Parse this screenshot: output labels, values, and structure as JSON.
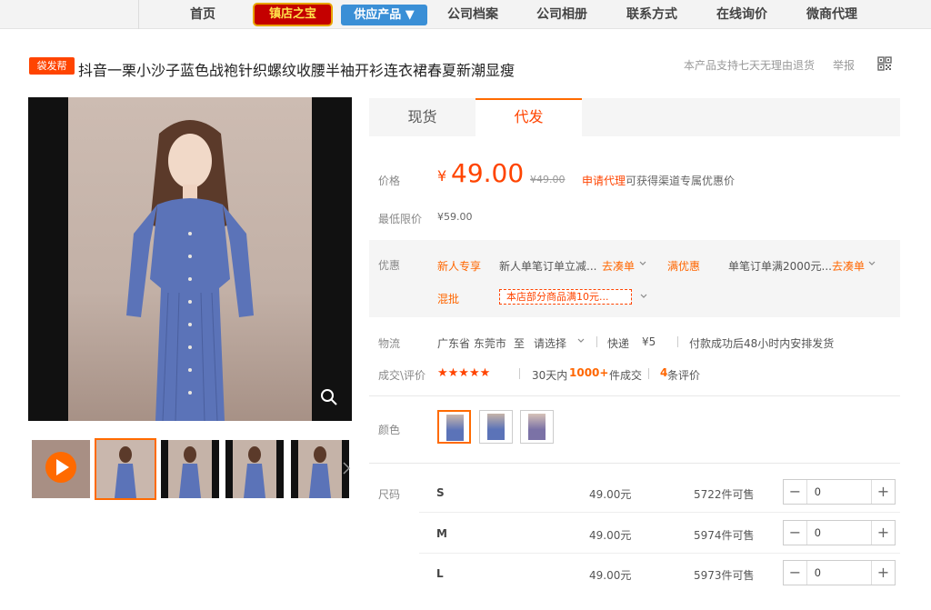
{
  "nav": {
    "items": [
      "首页",
      "公司档案",
      "公司相册",
      "联系方式",
      "在线询价",
      "微商代理"
    ],
    "shop_badge": "镇店之宝",
    "supply_label": "供应产品 ▼"
  },
  "header": {
    "tag": "袋发帮",
    "title": "抖音一栗小沙子蓝色战袍针织螺纹收腰半袖开衫连衣裙春夏新潮显瘦",
    "return_policy": "本产品支持七天无理由退货",
    "report": "举报",
    "qr_icon": "qr-code-icon"
  },
  "tabs": [
    "现货",
    "代发"
  ],
  "price": {
    "label": "价格",
    "currency": "¥",
    "value": "49.00",
    "original": "¥49.00",
    "agent_link": "申请代理",
    "agent_text": "可获得渠道专属优惠价",
    "min_label": "最低限价",
    "min_value": "¥59.00"
  },
  "promo": {
    "label": "优惠",
    "new_user": "新人专享",
    "new_user_desc": "新人单笔订单立减...",
    "go1": "去凑单",
    "full": "满优惠",
    "full_desc": "单笔订单满2000元...",
    "go2": "去凑单",
    "mixed": "混批",
    "mixed_desc": "本店部分商品满10元..."
  },
  "logistics": {
    "label": "物流",
    "from": "广东省 东莞市",
    "to": "至",
    "select": "请选择",
    "method": "快递",
    "fee": "¥5",
    "note": "付款成功后48小时内安排发货"
  },
  "deals": {
    "label": "成交\\评价",
    "stars": "★★★★★",
    "period": "30天内",
    "count": "1000+",
    "unit": "件成交",
    "reviews_num": "4",
    "reviews_text": "条评价"
  },
  "color": {
    "label": "颜色"
  },
  "size": {
    "label": "尺码",
    "rows": [
      {
        "size": "S",
        "price": "49.00元",
        "stock": "5722件可售",
        "qty": "0"
      },
      {
        "size": "M",
        "price": "49.00元",
        "stock": "5974件可售",
        "qty": "0"
      },
      {
        "size": "L",
        "price": "49.00元",
        "stock": "5973件可售",
        "qty": "0"
      }
    ]
  }
}
